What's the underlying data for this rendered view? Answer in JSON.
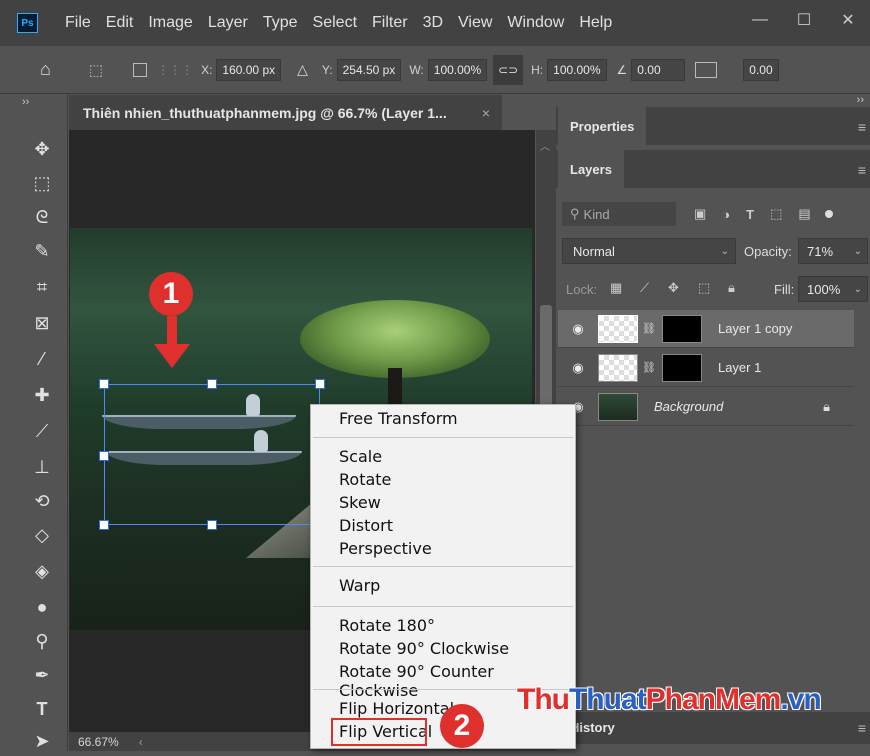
{
  "app": {
    "logo_text": "Ps"
  },
  "menubar": [
    "File",
    "Edit",
    "Image",
    "Layer",
    "Type",
    "Select",
    "Filter",
    "3D",
    "View",
    "Window",
    "Help"
  ],
  "window_controls": [
    "—",
    "☐",
    "✕"
  ],
  "options_bar": {
    "x_label": "X:",
    "x_value": "160.00 px",
    "y_label": "Y:",
    "y_value": "254.50 px",
    "w_label": "W:",
    "w_value": "100.00%",
    "h_label": "H:",
    "h_value": "100.00%",
    "angle_value": "0.00",
    "skew_value": "0.00"
  },
  "document": {
    "tab_title": "Thiên nhien_thuthuatphanmem.jpg @ 66.7% (Layer 1...",
    "close": "×",
    "zoom": "66.67%"
  },
  "panels": {
    "properties_tab": "Properties",
    "layers_tab": "Layers",
    "kind_placeholder": "Kind",
    "blend_mode": "Normal",
    "opacity_label": "Opacity:",
    "opacity_value": "71%",
    "lock_label": "Lock:",
    "fill_label": "Fill:",
    "fill_value": "100%",
    "layers": [
      {
        "name": "Layer 1 copy",
        "selected": true
      },
      {
        "name": "Layer 1",
        "selected": false
      },
      {
        "name": "Background",
        "selected": false
      }
    ],
    "history_tab": "History"
  },
  "context_menu": {
    "items": [
      "Free Transform",
      "Scale",
      "Rotate",
      "Skew",
      "Distort",
      "Perspective",
      "Warp",
      "Rotate 180°",
      "Rotate 90° Clockwise",
      "Rotate 90° Counter Clockwise",
      "Flip Horizontal",
      "Flip Vertical"
    ]
  },
  "annotations": {
    "badge1": "1",
    "badge2": "2"
  },
  "watermark": {
    "part1": "Thu",
    "part2": "Thuat",
    "part3": "PhanMem",
    "part4": ".vn"
  },
  "colors": {
    "accent_blue": "#31a8ff",
    "badge_red": "#e0302e",
    "highlight_box": "#e0302e",
    "watermark_red": "#e0302e",
    "watermark_blue": "#2a5fc4"
  }
}
